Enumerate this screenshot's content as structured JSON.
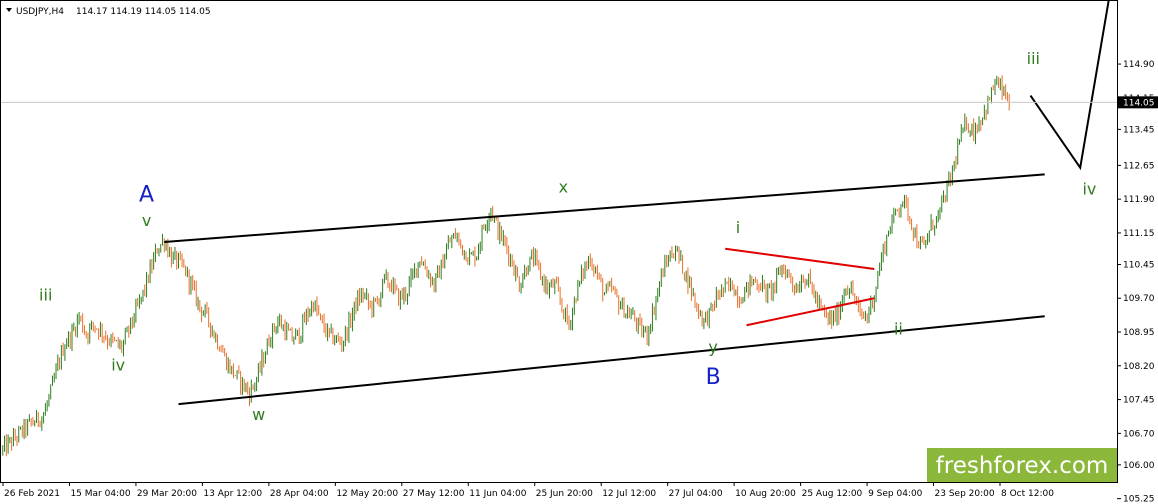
{
  "header": {
    "symbol": "USDJPY,H4",
    "ohlc": "114.17 114.19 114.05 114.05"
  },
  "watermark": {
    "text": "freshforex.com",
    "bg_color": "#8bb83a",
    "text_color": "#ffffff"
  },
  "chart_data": {
    "type": "candlestick",
    "ylim": [
      105.62,
      116.3
    ],
    "y_ticks": [
      "114.90",
      "114.15",
      "113.45",
      "112.65",
      "111.90",
      "111.15",
      "110.45",
      "109.70",
      "108.95",
      "108.20",
      "107.45",
      "106.70",
      "106.00",
      "105.25"
    ],
    "x_ticks": [
      "26 Feb 2021",
      "15 Mar 04:00",
      "29 Mar 20:00",
      "13 Apr 12:00",
      "28 Apr 04:00",
      "12 May 20:00",
      "27 May 12:00",
      "11 Jun 04:00",
      "25 Jun 20:00",
      "12 Jul 12:00",
      "27 Jul 04:00",
      "10 Aug 20:00",
      "25 Aug 12:00",
      "9 Sep 04:00",
      "23 Sep 20:00",
      "8 Oct 12:00"
    ],
    "current_price": "114.05",
    "colors": {
      "bull": "#2e7d1f",
      "bear": "#e8702a",
      "red_lines": "#e00000",
      "black_lines": "#000000",
      "green_labels": "#2e7d1f",
      "blue_labels": "#1420c8"
    },
    "price_path": [
      [
        0,
        106.3
      ],
      [
        2,
        106.6
      ],
      [
        4,
        106.9
      ],
      [
        6,
        107.1
      ],
      [
        7,
        107.6
      ],
      [
        8,
        108.2
      ],
      [
        9,
        108.7
      ],
      [
        10,
        108.9
      ],
      [
        11,
        109.3
      ],
      [
        12,
        108.9
      ],
      [
        13,
        109.1
      ],
      [
        14,
        109.0
      ],
      [
        15,
        108.8
      ],
      [
        16,
        108.7
      ],
      [
        17,
        108.6
      ],
      [
        18,
        109.0
      ],
      [
        19,
        109.4
      ],
      [
        20,
        109.8
      ],
      [
        21,
        110.3
      ],
      [
        22,
        110.8
      ],
      [
        23,
        111.0
      ],
      [
        24,
        110.6
      ],
      [
        25,
        110.5
      ],
      [
        26,
        110.3
      ],
      [
        27,
        109.9
      ],
      [
        28,
        109.5
      ],
      [
        29,
        109.3
      ],
      [
        30,
        108.9
      ],
      [
        31,
        108.6
      ],
      [
        32,
        108.2
      ],
      [
        33,
        108.0
      ],
      [
        34,
        107.8
      ],
      [
        35,
        107.6
      ],
      [
        36,
        107.9
      ],
      [
        37,
        108.4
      ],
      [
        38,
        108.9
      ],
      [
        39,
        109.2
      ],
      [
        40,
        109.0
      ],
      [
        41,
        108.8
      ],
      [
        42,
        108.9
      ],
      [
        43,
        109.3
      ],
      [
        44,
        109.6
      ],
      [
        45,
        109.2
      ],
      [
        46,
        108.9
      ],
      [
        47,
        108.8
      ],
      [
        48,
        108.7
      ],
      [
        49,
        109.1
      ],
      [
        50,
        109.6
      ],
      [
        51,
        109.8
      ],
      [
        52,
        109.5
      ],
      [
        53,
        109.6
      ],
      [
        54,
        110.1
      ],
      [
        55,
        110.0
      ],
      [
        56,
        109.7
      ],
      [
        57,
        109.8
      ],
      [
        58,
        110.2
      ],
      [
        59,
        110.6
      ],
      [
        60,
        110.3
      ],
      [
        61,
        110.0
      ],
      [
        62,
        110.4
      ],
      [
        63,
        110.9
      ],
      [
        64,
        111.1
      ],
      [
        65,
        110.8
      ],
      [
        66,
        110.6
      ],
      [
        67,
        110.7
      ],
      [
        68,
        111.3
      ],
      [
        69,
        111.7
      ],
      [
        70,
        111.2
      ],
      [
        71,
        110.9
      ],
      [
        72,
        110.5
      ],
      [
        73,
        110.0
      ],
      [
        74,
        110.4
      ],
      [
        75,
        110.6
      ],
      [
        76,
        110.2
      ],
      [
        77,
        109.9
      ],
      [
        78,
        110.0
      ],
      [
        79,
        109.5
      ],
      [
        80,
        109.1
      ],
      [
        81,
        109.8
      ],
      [
        82,
        110.3
      ],
      [
        83,
        110.6
      ],
      [
        84,
        110.2
      ],
      [
        85,
        109.8
      ],
      [
        86,
        109.9
      ],
      [
        87,
        109.6
      ],
      [
        88,
        109.4
      ],
      [
        89,
        109.3
      ],
      [
        90,
        109.0
      ],
      [
        91,
        108.9
      ],
      [
        92,
        109.5
      ],
      [
        93,
        110.2
      ],
      [
        94,
        110.6
      ],
      [
        95,
        110.8
      ],
      [
        96,
        110.4
      ],
      [
        97,
        110.0
      ],
      [
        98,
        109.5
      ],
      [
        99,
        109.2
      ],
      [
        100,
        109.4
      ],
      [
        101,
        109.8
      ],
      [
        102,
        109.9
      ],
      [
        103,
        110.0
      ],
      [
        104,
        109.7
      ],
      [
        105,
        109.9
      ],
      [
        106,
        110.1
      ],
      [
        107,
        110.0
      ],
      [
        108,
        109.8
      ],
      [
        109,
        110.0
      ],
      [
        110,
        110.4
      ],
      [
        111,
        110.2
      ],
      [
        112,
        109.9
      ],
      [
        113,
        110.2
      ],
      [
        114,
        110.0
      ],
      [
        115,
        109.6
      ],
      [
        116,
        109.3
      ],
      [
        117,
        109.2
      ],
      [
        118,
        109.4
      ],
      [
        119,
        110.0
      ],
      [
        120,
        109.8
      ],
      [
        121,
        109.3
      ],
      [
        122,
        109.3
      ],
      [
        123,
        109.8
      ],
      [
        124,
        110.6
      ],
      [
        125,
        111.2
      ],
      [
        126,
        111.6
      ],
      [
        127,
        111.9
      ],
      [
        128,
        111.5
      ],
      [
        129,
        111.0
      ],
      [
        130,
        110.8
      ],
      [
        131,
        111.3
      ],
      [
        132,
        111.5
      ],
      [
        133,
        112.0
      ],
      [
        134,
        112.5
      ],
      [
        135,
        113.2
      ],
      [
        136,
        113.6
      ],
      [
        137,
        113.4
      ],
      [
        138,
        113.7
      ],
      [
        139,
        114.0
      ],
      [
        140,
        114.5
      ],
      [
        141,
        114.3
      ],
      [
        142,
        114.05
      ]
    ],
    "trend_lines": [
      {
        "name": "upper-channel",
        "points": [
          [
            23,
            110.95
          ],
          [
            147,
            112.45
          ]
        ],
        "color": "#000000"
      },
      {
        "name": "lower-channel",
        "points": [
          [
            25,
            107.35
          ],
          [
            147,
            109.3
          ]
        ],
        "color": "#000000"
      },
      {
        "name": "triangle-upper",
        "points": [
          [
            102,
            110.8
          ],
          [
            123,
            110.35
          ]
        ],
        "color": "#e00000"
      },
      {
        "name": "triangle-lower",
        "points": [
          [
            105,
            109.1
          ],
          [
            123,
            109.7
          ]
        ],
        "color": "#e00000"
      },
      {
        "name": "projection",
        "points": [
          [
            145,
            114.2
          ],
          [
            152,
            112.6
          ],
          [
            156,
            116.3
          ]
        ],
        "color": "#000000"
      }
    ],
    "wave_labels": [
      {
        "text": "A",
        "x": 20.5,
        "y": 111.85,
        "color": "#1420c8",
        "size": 22
      },
      {
        "text": "v",
        "x": 20.5,
        "y": 111.3,
        "color": "#2e7d1f",
        "size": 16
      },
      {
        "text": "iii",
        "x": 6.3,
        "y": 109.65,
        "color": "#2e7d1f",
        "size": 16
      },
      {
        "text": "iv",
        "x": 16.5,
        "y": 108.1,
        "color": "#2e7d1f",
        "size": 16
      },
      {
        "text": "w",
        "x": 36.3,
        "y": 107.0,
        "color": "#2e7d1f",
        "size": 16
      },
      {
        "text": "x",
        "x": 79.2,
        "y": 112.05,
        "color": "#2e7d1f",
        "size": 16
      },
      {
        "text": "i",
        "x": 103.8,
        "y": 111.15,
        "color": "#2e7d1f",
        "size": 16
      },
      {
        "text": "y",
        "x": 100.3,
        "y": 108.5,
        "color": "#2e7d1f",
        "size": 16
      },
      {
        "text": "B",
        "x": 100.3,
        "y": 107.8,
        "color": "#1420c8",
        "size": 22
      },
      {
        "text": "ii",
        "x": 126.4,
        "y": 108.9,
        "color": "#2e7d1f",
        "size": 16
      },
      {
        "text": "iii",
        "x": 145.4,
        "y": 114.9,
        "color": "#2e7d1f",
        "size": 16
      },
      {
        "text": "iv",
        "x": 153.3,
        "y": 112.0,
        "color": "#2e7d1f",
        "size": 16
      }
    ]
  }
}
